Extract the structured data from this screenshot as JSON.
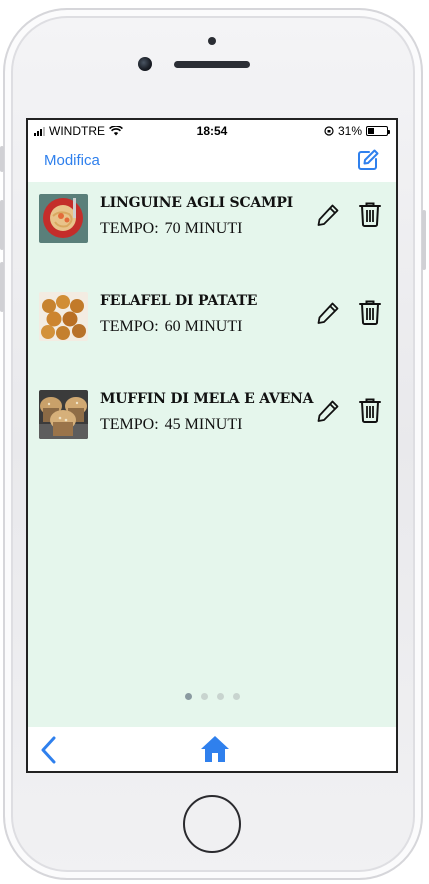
{
  "status": {
    "carrier": "WINDTRE",
    "time": "18:54",
    "battery": "31%",
    "battery_level": 0.31
  },
  "nav": {
    "edit_label": "Modifica",
    "compose_icon": "compose-icon"
  },
  "recipes": [
    {
      "title": "LINGUINE AGLI SCAMPI",
      "time_label": "TEMPO:",
      "time_value": "70 MINUTI"
    },
    {
      "title": "FELAFEL DI PATATE",
      "time_label": "TEMPO:",
      "time_value": "60 MINUTI"
    },
    {
      "title": "MUFFIN DI MELA E AVENA",
      "time_label": "TEMPO:",
      "time_value": "45 MINUTI"
    }
  ],
  "pager": {
    "count": 4,
    "active": 0
  },
  "colors": {
    "accent": "#2f80ed",
    "content_bg": "#e5f6ec"
  }
}
